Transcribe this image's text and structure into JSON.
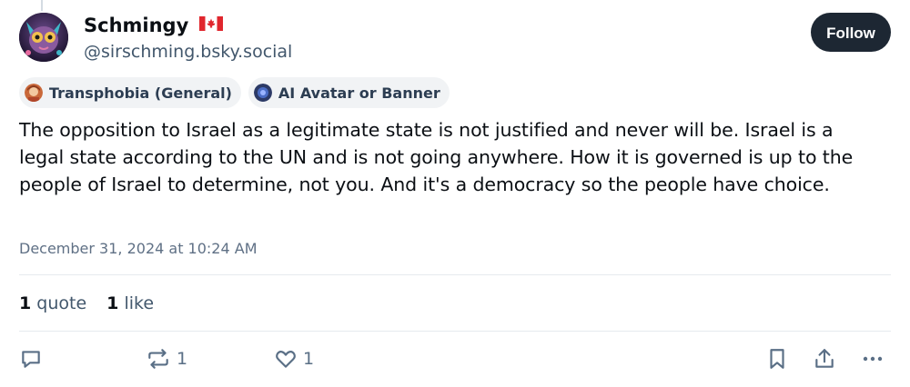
{
  "author": {
    "display_name": "Schmingy",
    "flag_icon": "canada-flag-emoji",
    "handle": "@sirschming.bsky.social"
  },
  "follow_button": {
    "label": "Follow"
  },
  "labels": [
    {
      "icon": "labeler-avatar-icon",
      "text": "Transphobia (General)"
    },
    {
      "icon": "labeler-avatar-icon",
      "text": "AI Avatar or Banner"
    }
  ],
  "post": {
    "text": "The opposition to Israel as a legitimate state is not justified and never will be. Israel is a legal state according to the UN and is not going anywhere. How it is governed is up to the people of Israel to determine, not you. And it's a democracy so the people have choice.",
    "timestamp": "December 31, 2024 at 10:24 AM"
  },
  "stats": {
    "quotes_count": "1",
    "quotes_label": "quote",
    "likes_count": "1",
    "likes_label": "like"
  },
  "actions": {
    "reply_icon": "speech-bubble-icon",
    "repost_icon": "repost-arrows-icon",
    "repost_count": "1",
    "like_icon": "heart-icon",
    "like_count": "1",
    "bookmark_icon": "bookmark-icon",
    "share_icon": "share-icon",
    "more_icon": "ellipsis-icon"
  },
  "colors": {
    "follow_bg": "#1d2733",
    "text": "#0b0f14",
    "muted": "#42576c",
    "icon": "#5a6f86",
    "chip_bg": "#f1f3f5"
  }
}
